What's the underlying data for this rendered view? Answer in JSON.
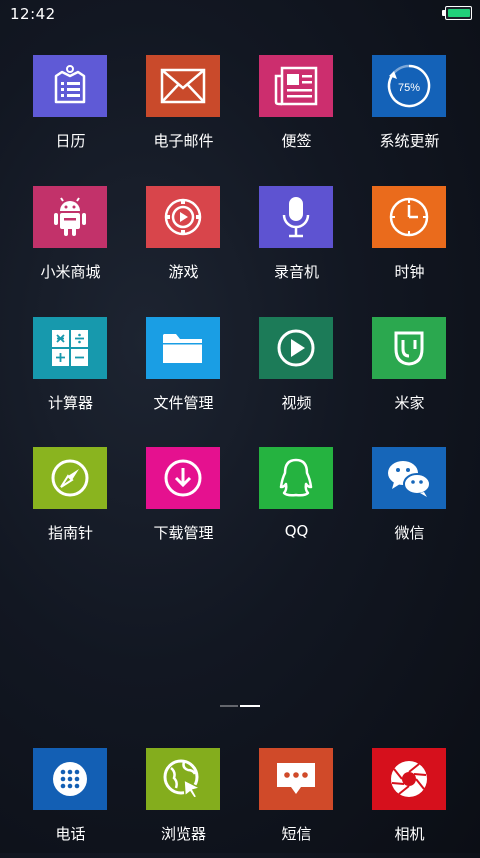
{
  "status_bar": {
    "time": "12:42",
    "battery_level": 0.95,
    "battery_color": "#21d07a"
  },
  "apps": [
    {
      "label": "日历",
      "icon": "calendar-icon",
      "color": "#5f5ad6"
    },
    {
      "label": "电子邮件",
      "icon": "mail-icon",
      "color": "#c94a2b"
    },
    {
      "label": "便签",
      "icon": "notes-icon",
      "color": "#cc2e6e"
    },
    {
      "label": "系统更新",
      "icon": "update-icon",
      "color": "#1462b8",
      "badge": "75%"
    },
    {
      "label": "小米商城",
      "icon": "android-store-icon",
      "color": "#c2326a"
    },
    {
      "label": "游戏",
      "icon": "game-icon",
      "color": "#d8454b"
    },
    {
      "label": "录音机",
      "icon": "microphone-icon",
      "color": "#5e53d1"
    },
    {
      "label": "时钟",
      "icon": "clock-icon",
      "color": "#ea6b1c"
    },
    {
      "label": "计算器",
      "icon": "calculator-icon",
      "color": "#1799ad"
    },
    {
      "label": "文件管理",
      "icon": "folder-icon",
      "color": "#1a9ee4"
    },
    {
      "label": "视频",
      "icon": "play-icon",
      "color": "#1c7b58"
    },
    {
      "label": "米家",
      "icon": "mijia-icon",
      "color": "#2ba84f"
    },
    {
      "label": "指南针",
      "icon": "compass-icon",
      "color": "#8ab41f"
    },
    {
      "label": "下载管理",
      "icon": "download-icon",
      "color": "#e5118f"
    },
    {
      "label": "QQ",
      "icon": "qq-penguin-icon",
      "color": "#25b340"
    },
    {
      "label": "微信",
      "icon": "wechat-icon",
      "color": "#1666b9"
    }
  ],
  "dock": [
    {
      "label": "电话",
      "icon": "phone-dialpad-icon",
      "color": "#135fb4"
    },
    {
      "label": "浏览器",
      "icon": "browser-icon",
      "color": "#84ad1d"
    },
    {
      "label": "短信",
      "icon": "message-icon",
      "color": "#d04a29"
    },
    {
      "label": "相机",
      "icon": "camera-shutter-icon",
      "color": "#d6101c"
    }
  ],
  "page_indicator": {
    "pages": 2,
    "current": 2
  }
}
